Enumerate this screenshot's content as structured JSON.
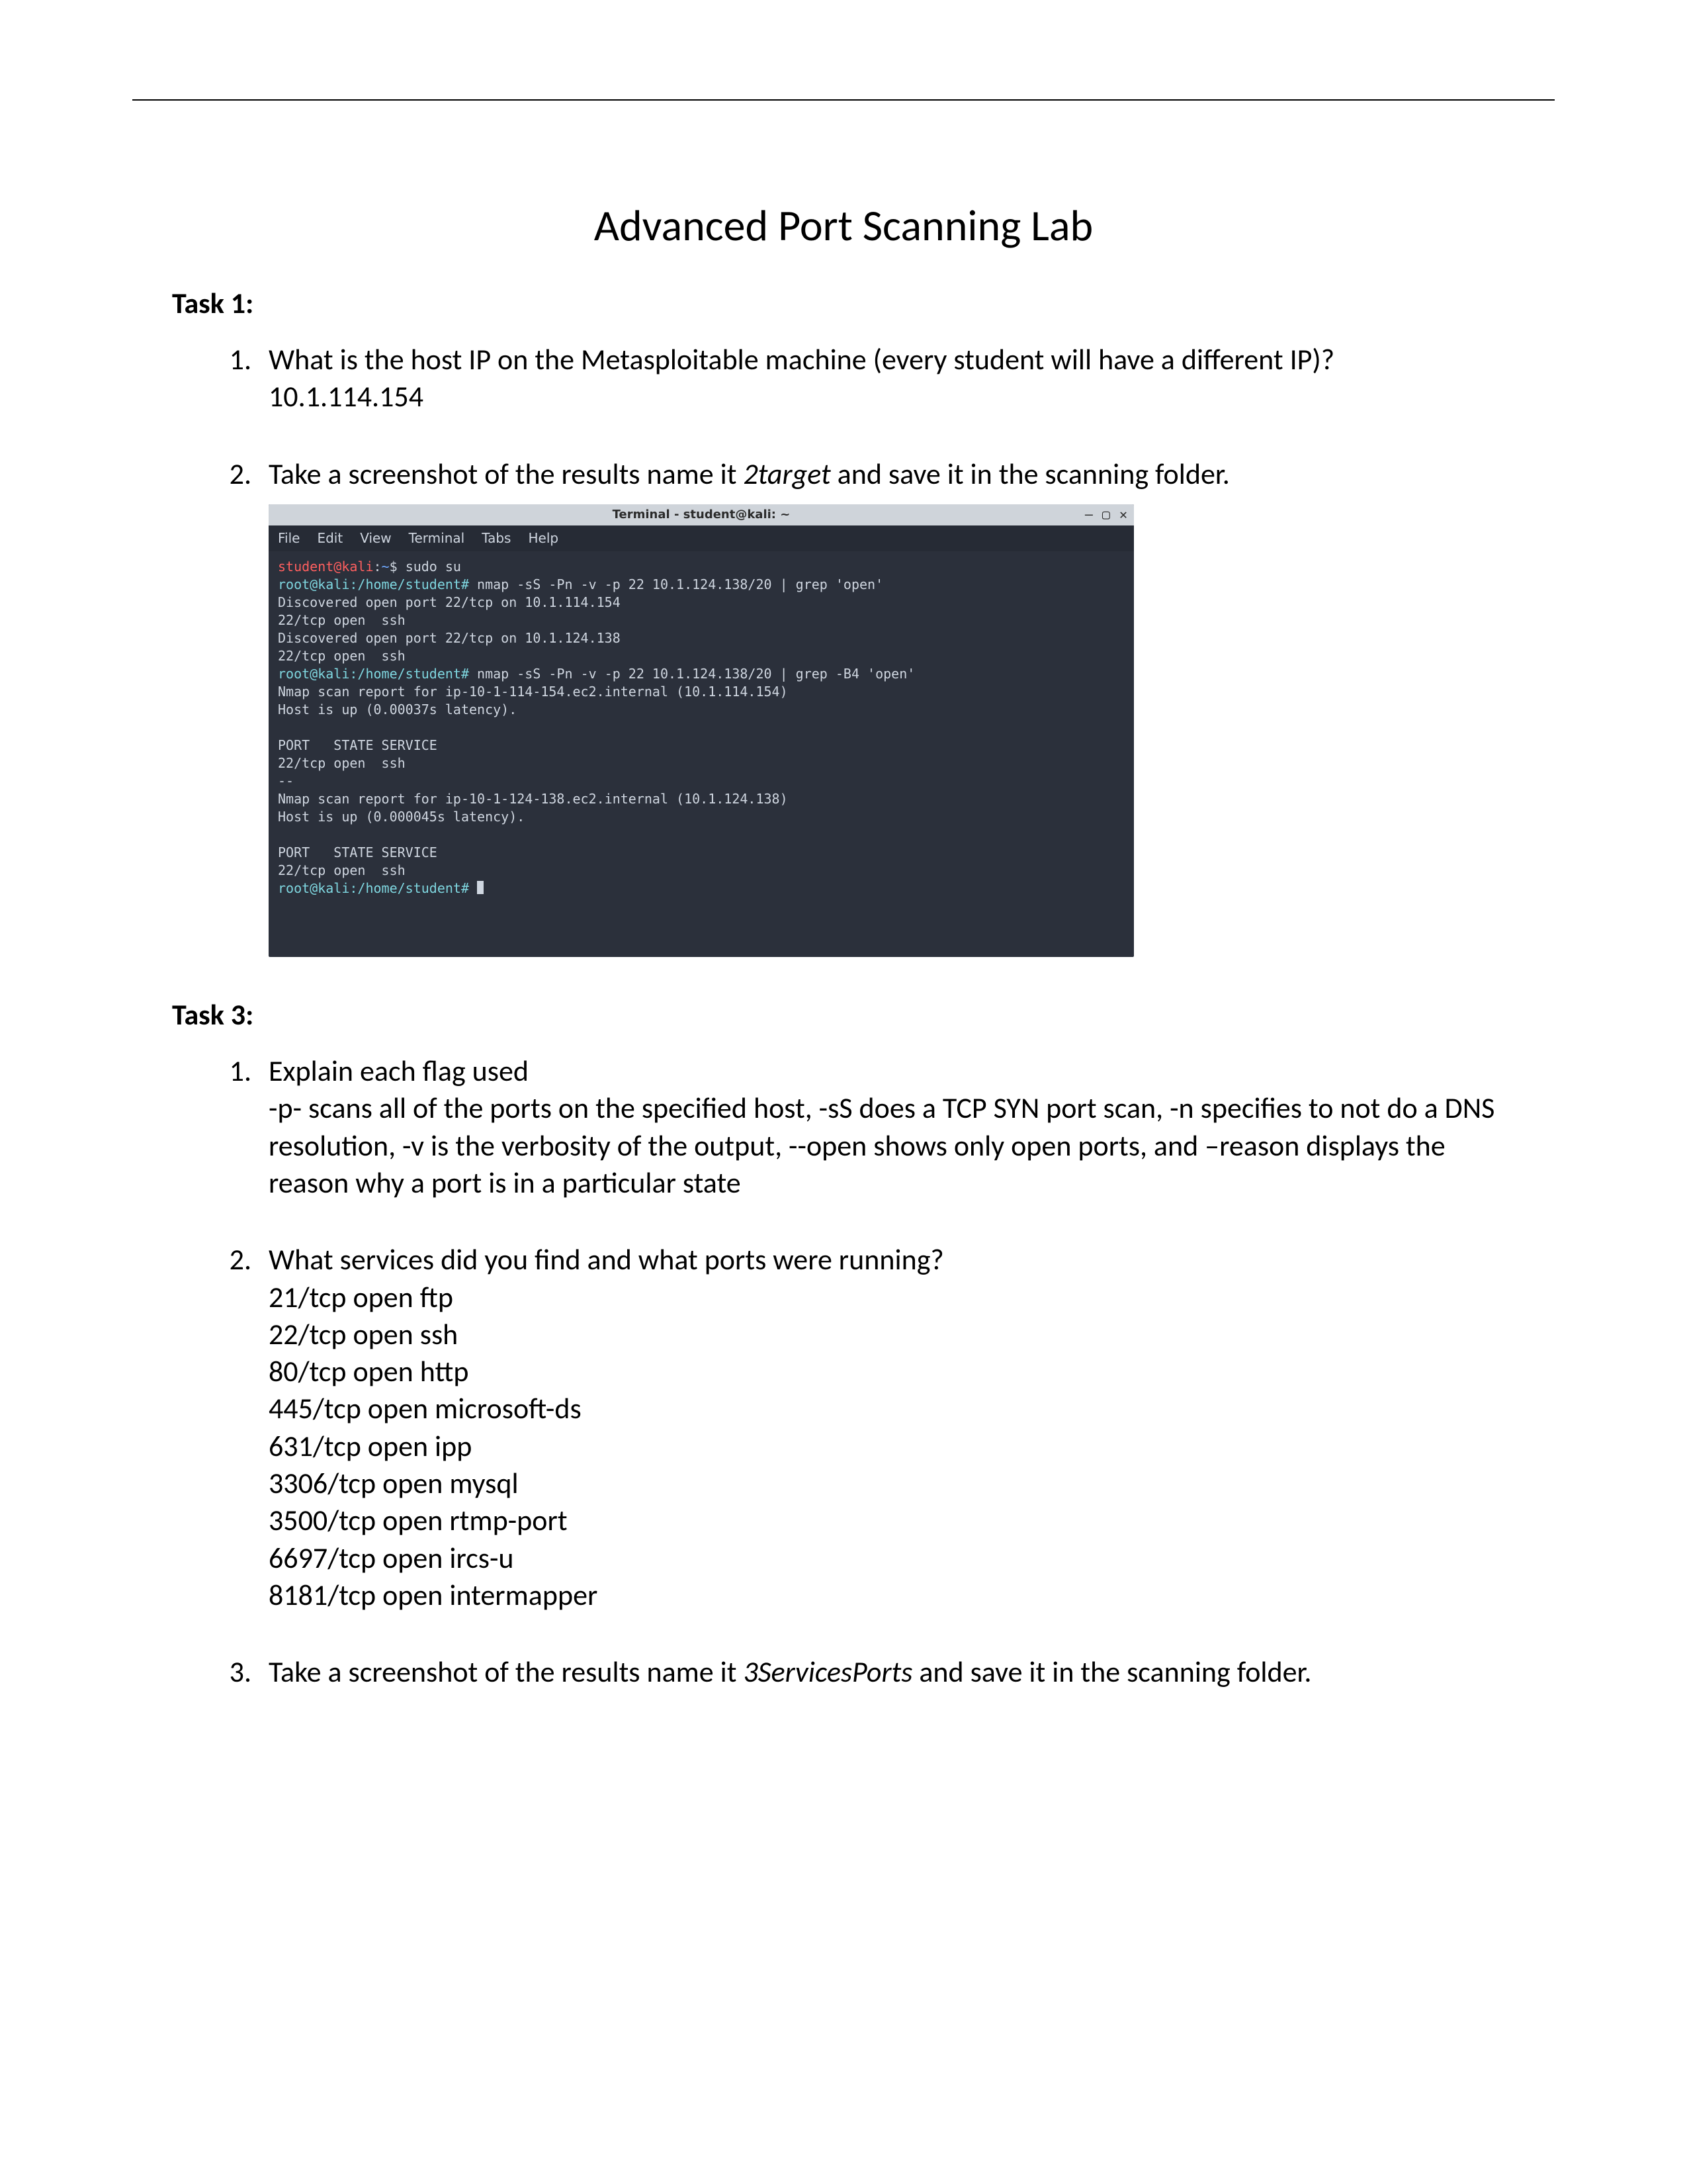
{
  "doc": {
    "title": "Advanced Port Scanning Lab",
    "task1_head": "Task 1:",
    "task1_q1": "What is the host IP on the Metasploitable machine (every student will have a different IP)?",
    "task1_a1": "10.1.114.154",
    "task1_q2_pre": "Take a screenshot of the results name it ",
    "task1_q2_em": "2target",
    "task1_q2_post": " and save it in the scanning folder.",
    "task3_head": "Task 3:",
    "task3_q1": "Explain each flag used",
    "task3_a1": "-p- scans all of the ports on the specified host, -sS does a TCP SYN port scan, -n specifies to not do a DNS resolution, -v is the verbosity of the output, --open shows only open ports, and –reason displays the reason why a port is in a particular state",
    "task3_q2": "What services did you find and what ports were running?",
    "ports": [
      "21/tcp   open  ftp",
      "22/tcp   open  ssh",
      "80/tcp   open  http",
      "445/tcp  open  microsoft-ds",
      "631/tcp  open  ipp",
      "3306/tcp open  mysql",
      "3500/tcp open  rtmp-port",
      "6697/tcp open  ircs-u",
      "8181/tcp open  intermapper"
    ],
    "task3_q3_pre": "Take a screenshot of the results name it ",
    "task3_q3_em": "3ServicesPorts",
    "task3_q3_post": " and save it in the scanning folder."
  },
  "terminal": {
    "titlebar": "Terminal - student@kali: ~",
    "min": "—",
    "max": "▢",
    "close": "✕",
    "menu": {
      "file": "File",
      "edit": "Edit",
      "view": "View",
      "terminal": "Terminal",
      "tabs": "Tabs",
      "help": "Help"
    },
    "p_user": "student@kali",
    "p_sep1": ":",
    "p_path": "~",
    "p_dollar": "$ ",
    "cmd_sudo": "sudo su",
    "root_prompt1": "root@kali:/home/student# ",
    "cmd_nmap1": "nmap -sS -Pn -v -p 22 10.1.124.138/20 | grep 'open'",
    "l_disc1": "Discovered open port 22/tcp on 10.1.114.154",
    "l_open1": "22/tcp open  ssh",
    "l_disc2": "Discovered open port 22/tcp on 10.1.124.138",
    "l_open2": "22/tcp open  ssh",
    "root_prompt2": "root@kali:/home/student# ",
    "cmd_nmap2": "nmap -sS -Pn -v -p 22 10.1.124.138/20 | grep -B4 'open'",
    "l_report1": "Nmap scan report for ip-10-1-114-154.ec2.internal (10.1.114.154)",
    "l_lat1": "Host is up (0.00037s latency).",
    "blank1": " ",
    "l_hdr1": "PORT   STATE SERVICE",
    "l_open3": "22/tcp open  ssh",
    "l_dash": "--",
    "l_report2": "Nmap scan report for ip-10-1-124-138.ec2.internal (10.1.124.138)",
    "l_lat2": "Host is up (0.000045s latency).",
    "blank2": " ",
    "l_hdr2": "PORT   STATE SERVICE",
    "l_open4": "22/tcp open  ssh",
    "root_prompt3": "root@kali:/home/student# "
  }
}
